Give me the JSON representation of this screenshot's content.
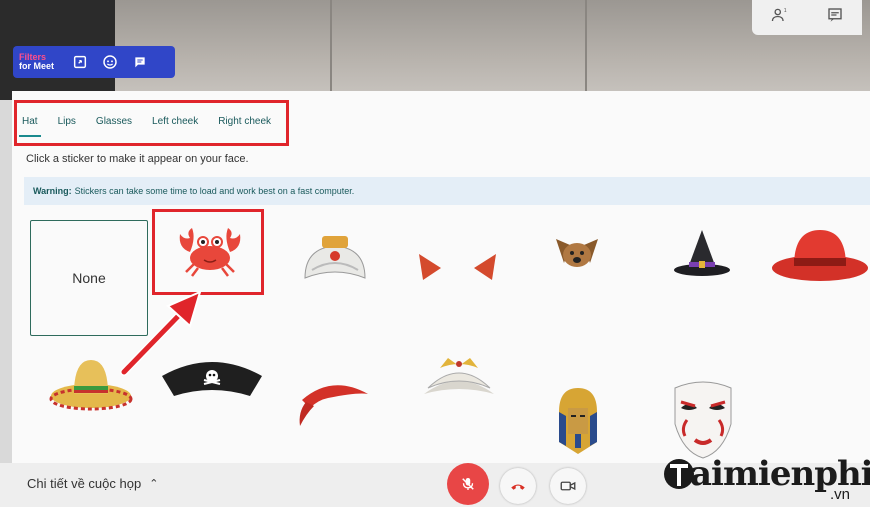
{
  "extension": {
    "title_line1": "Filters",
    "title_line2": "for Meet",
    "buttons": [
      "picture-in-picture-icon",
      "face-icon",
      "chat-icon"
    ]
  },
  "top_controls": [
    "people-icon",
    "chat-icon"
  ],
  "tabs": [
    {
      "label": "Hat",
      "active": true
    },
    {
      "label": "Lips",
      "active": false
    },
    {
      "label": "Glasses",
      "active": false
    },
    {
      "label": "Left cheek",
      "active": false
    },
    {
      "label": "Right cheek",
      "active": false
    }
  ],
  "hint": "Click a sticker to make it appear on your face.",
  "warning": {
    "label": "Warning:",
    "text": "Stickers can take some time to load and work best on a fast computer."
  },
  "stickers": {
    "none_label": "None",
    "items": [
      "crab",
      "turban",
      "horns",
      "dog-ears",
      "witch-hat",
      "fedora",
      "sombrero",
      "pirate-hat",
      "bandana",
      "crown",
      "pharaoh-mask",
      "kabuki-mask"
    ]
  },
  "bottom_bar": {
    "meeting_details": "Chi tiết về cuộc họp",
    "accent_red": "#e84646"
  },
  "watermark": {
    "main": "aimienphi",
    "sub": ".vn"
  }
}
